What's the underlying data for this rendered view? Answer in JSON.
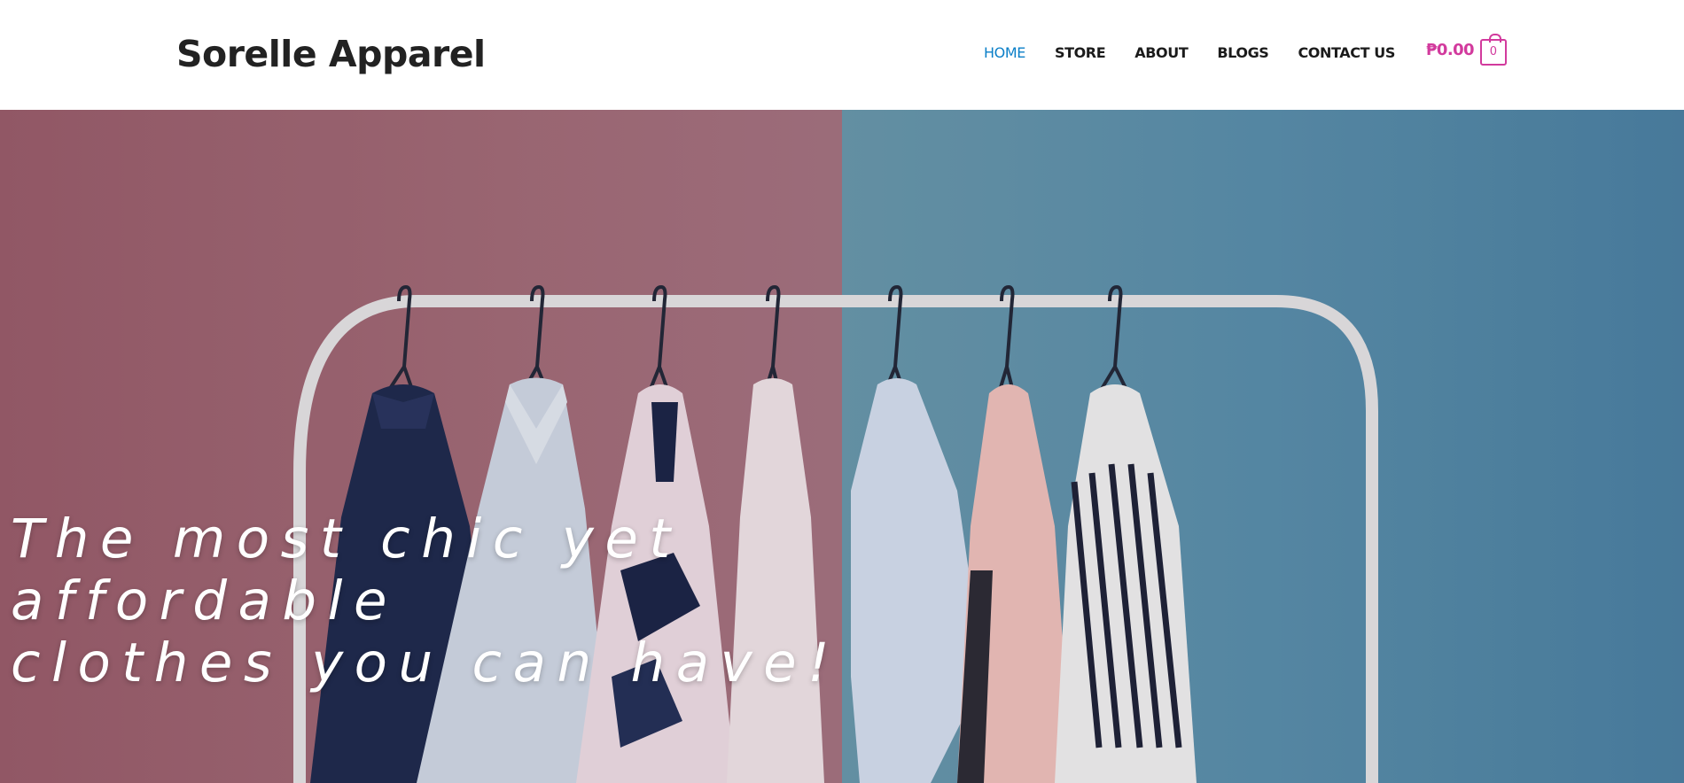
{
  "header": {
    "site_title": "Sorelle Apparel",
    "nav": [
      {
        "label": "HOME",
        "active": true
      },
      {
        "label": "STORE",
        "active": false
      },
      {
        "label": "ABOUT",
        "active": false
      },
      {
        "label": "BLOGS",
        "active": false
      },
      {
        "label": "CONTACT US",
        "active": false
      }
    ],
    "cart": {
      "total": "₱0.00",
      "count": "0",
      "icon": "shopping-bag-icon"
    }
  },
  "hero": {
    "heading_line1": "The most chic yet affordable",
    "heading_line2": "clothes you can have!",
    "image": "clothing-rack-photo"
  },
  "colors": {
    "nav_active": "#0b7fc8",
    "cart_accent": "#d23a9d",
    "hero_left_wall": "#a46c78",
    "hero_right_wall": "#5a90ad"
  }
}
